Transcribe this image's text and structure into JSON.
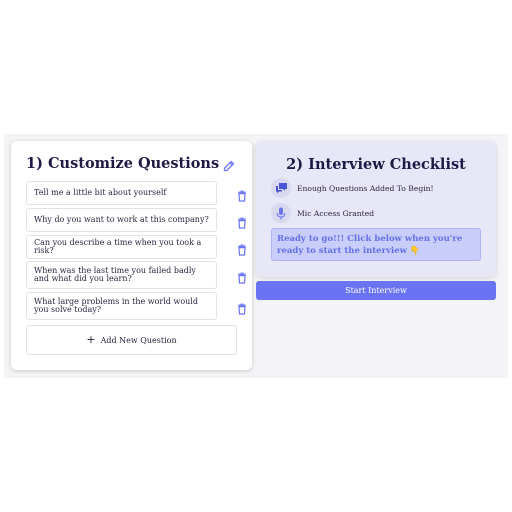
{
  "customize": {
    "title": "1) Customize Questions",
    "questions": [
      "Tell me a little bit about yourself",
      "Why do you want to work at this  company?",
      "Can you describe a time when you took a risk?",
      "When was the last time you failed badly and what did you learn?",
      "What large problems in the world would you solve today?"
    ],
    "add_label": "Add New Question",
    "icons": {
      "edit": "pencil-icon",
      "delete": "trash-icon",
      "add": "plus-icon"
    }
  },
  "checklist": {
    "title": "2) Interview Checklist",
    "items": [
      {
        "label": "Enough Questions Added To Begin!",
        "icon": "chat-bubbles-icon"
      },
      {
        "label": "Mic Access Granted",
        "icon": "microphone-icon"
      }
    ],
    "ready_message": "Ready to go!!! Click below when you're ready to start the interview 👇"
  },
  "start_button": {
    "label": "Start Interview"
  },
  "colors": {
    "accent": "#6a74f3",
    "checklist_bg": "#e7e7f8",
    "ready_bg": "#c8cdfa",
    "ready_text": "#6470e6",
    "title_text": "#1f1a45"
  }
}
